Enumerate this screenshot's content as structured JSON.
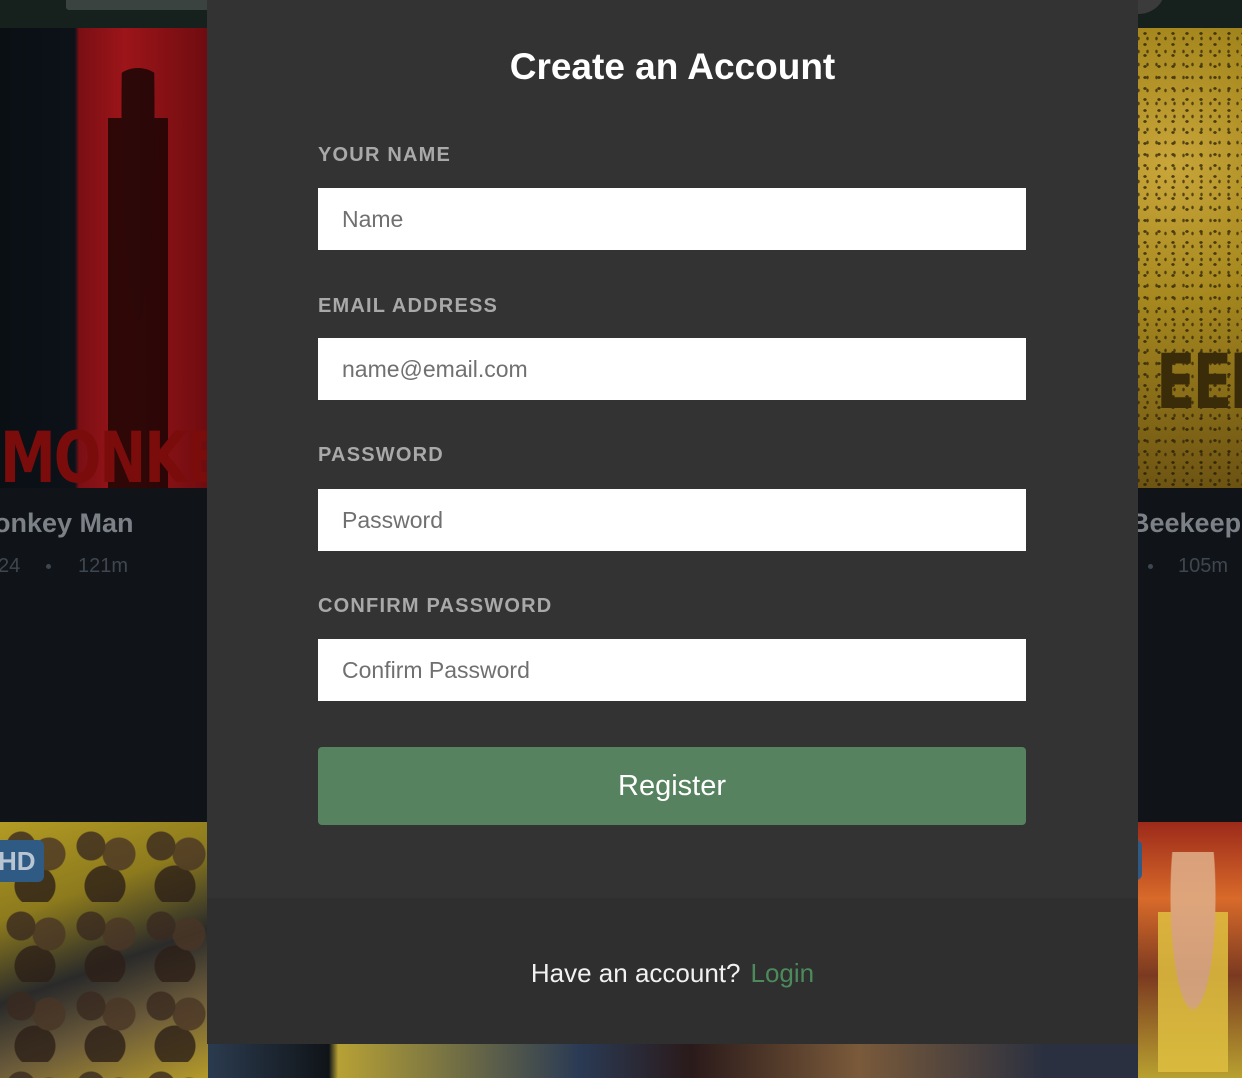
{
  "background": {
    "left_poster": {
      "poster_word": "MONKEY M",
      "title": "onkey Man",
      "year": "24",
      "duration": "121m"
    },
    "right_poster": {
      "poster_word": "EEKE",
      "title": "Beekeep",
      "duration": "105m"
    },
    "badge": "HD"
  },
  "modal": {
    "title": "Create an Account",
    "fields": [
      {
        "label": "YOUR NAME",
        "placeholder": "Name"
      },
      {
        "label": "EMAIL ADDRESS",
        "placeholder": "name@email.com"
      },
      {
        "label": "PASSWORD",
        "placeholder": "Password"
      },
      {
        "label": "CONFIRM PASSWORD",
        "placeholder": "Confirm Password"
      }
    ],
    "register_label": "Register",
    "footer": {
      "prompt": "Have an account?",
      "login_label": "Login"
    }
  },
  "colors": {
    "modal_bg": "#333333",
    "footer_bg": "#2f2f2f",
    "register_button": "#56825f",
    "login_link": "#4c8a5c",
    "label": "#a9a9a9"
  }
}
